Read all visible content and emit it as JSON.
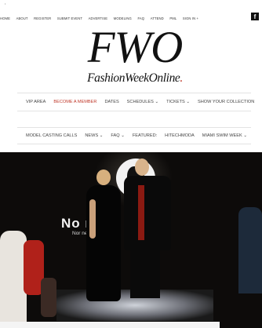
{
  "top_nav": {
    "items": [
      "HOME",
      "ABOUT",
      "REGISTER",
      "SUBMIT EVENT",
      "ADVERTISE",
      "MODELING",
      "FAQ",
      "ATTEND",
      "PML",
      "SIGN IN +"
    ],
    "facebook_glyph": "f"
  },
  "logo": {
    "initials": "FWO",
    "wordmark": "FashionWeekOnline",
    "wordmark_dot": "."
  },
  "main_menu": {
    "row1": [
      "VIP AREA",
      "BECOME A MEMBER",
      "DATES",
      "SCHEDULES",
      "TICKETS",
      "SHOW YOUR COLLECTION"
    ],
    "row2": [
      "MODEL CASTING CALLS",
      "NEWS",
      "FAQ",
      "FEATURED:",
      "HITECHMODA",
      "MIAMI SWIM WEEK"
    ],
    "active_color": "#c0392b"
  },
  "hero": {
    "banner_title": "No    rio",
    "banner_subtitle": "Nor         ner"
  }
}
